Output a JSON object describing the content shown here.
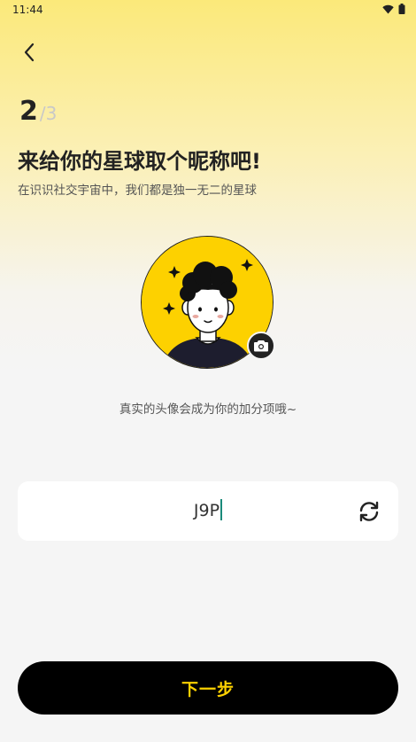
{
  "status_bar": {
    "time": "11:44",
    "icons": [
      "wifi-icon",
      "battery-icon"
    ]
  },
  "header": {
    "back_icon": "chevron-left-icon"
  },
  "progress": {
    "current": "2",
    "total": "/3"
  },
  "title": "来给你的星球取个昵称吧!",
  "subtitle": "在识识社交宇宙中，我们都是独一无二的星球",
  "avatar": {
    "camera_icon": "camera-icon"
  },
  "hint": "真实的头像会成为你的加分项哦~",
  "nickname": {
    "value": "J9P",
    "refresh_icon": "refresh-icon"
  },
  "next_button": {
    "label": "下一步"
  },
  "colors": {
    "accent_yellow": "#fdd100",
    "button_black": "#000000",
    "caret": "#1a8a7a"
  }
}
